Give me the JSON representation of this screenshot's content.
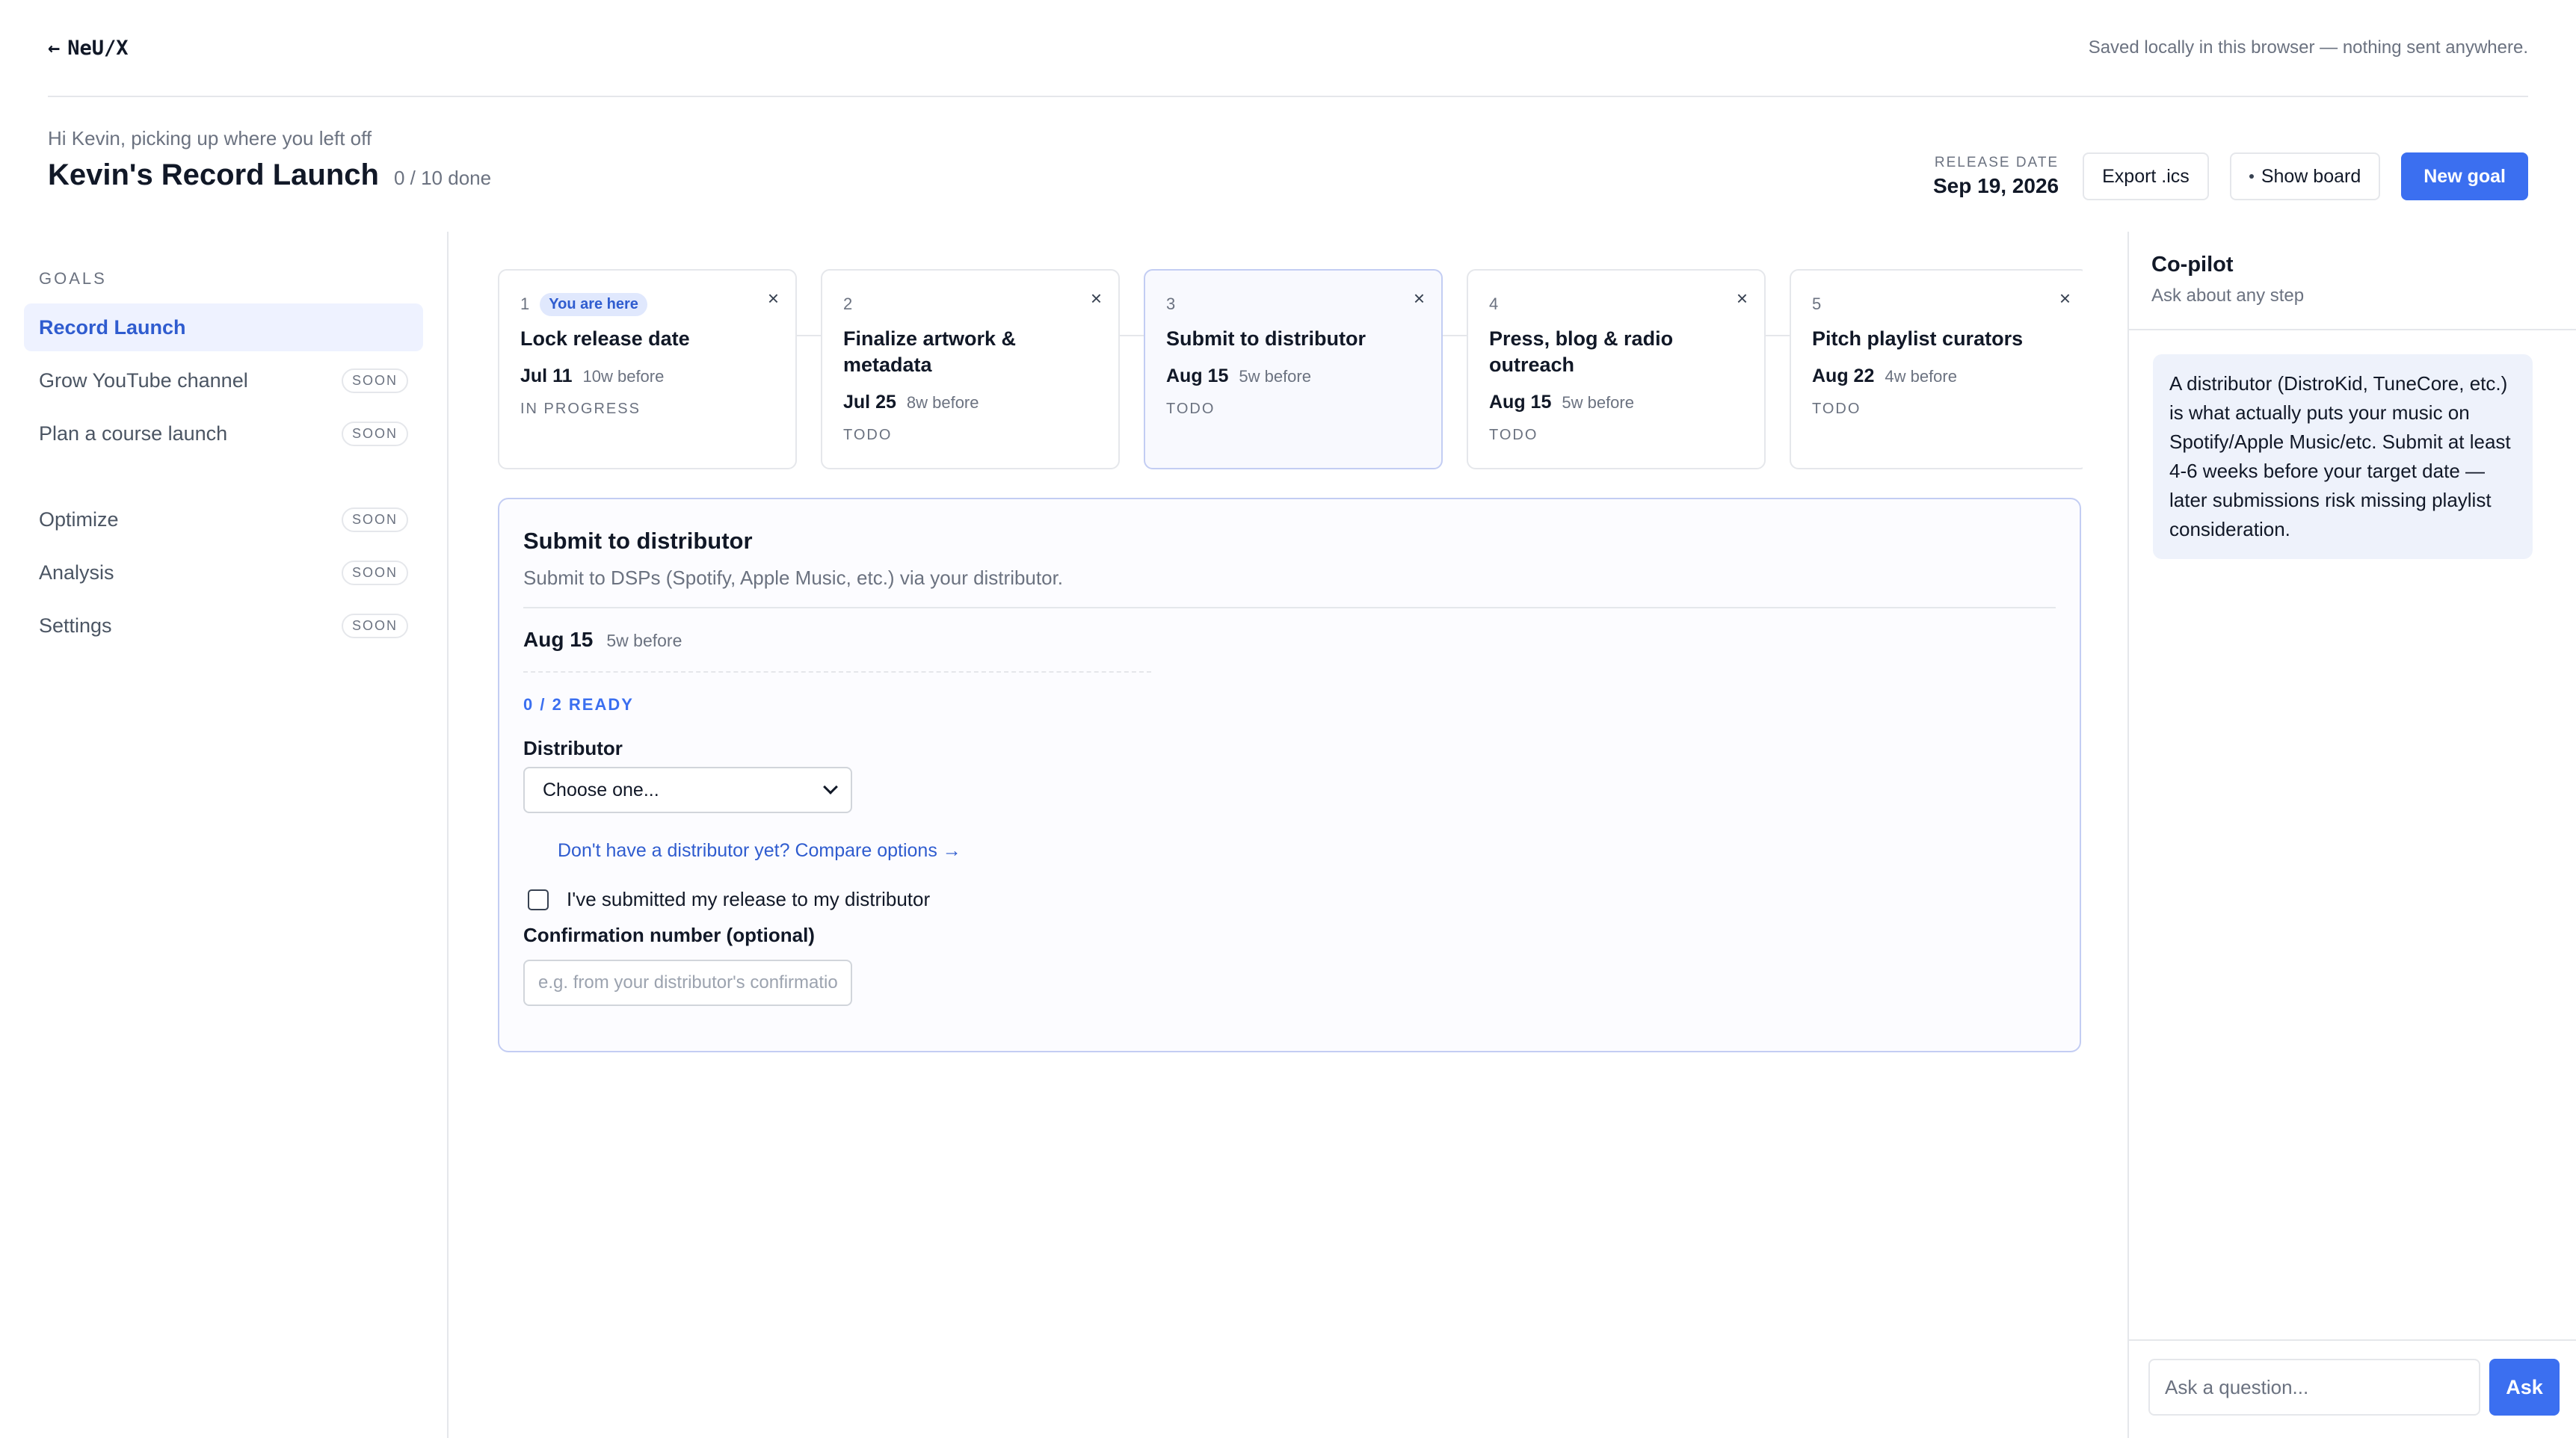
{
  "topbar": {
    "back_glyph": "←",
    "brand": "NeU/X",
    "saved_note": "Saved locally in this browser — nothing sent anywhere."
  },
  "header": {
    "greeting": "Hi Kevin, picking up where you left off",
    "title": "Kevin's Record Launch",
    "progress": "0 / 10 done",
    "release_label": "RELEASE DATE",
    "release_date": "Sep 19, 2026",
    "export_label": "Export .ics",
    "show_board_label": "Show board",
    "new_goal_label": "New goal"
  },
  "sidebar": {
    "heading": "GOALS",
    "items": [
      {
        "label": "Record Launch",
        "badge": ""
      },
      {
        "label": "Grow YouTube channel",
        "badge": "SOON"
      },
      {
        "label": "Plan a course launch",
        "badge": "SOON"
      },
      {
        "label": "Optimize",
        "badge": "SOON"
      },
      {
        "label": "Analysis",
        "badge": "SOON"
      },
      {
        "label": "Settings",
        "badge": "SOON"
      }
    ]
  },
  "steps": [
    {
      "num": "1",
      "badge": "You are here",
      "title": "Lock release date",
      "date": "Jul 11",
      "rel": "10w before",
      "status": "IN PROGRESS",
      "close": "×"
    },
    {
      "num": "2",
      "badge": "",
      "title": "Finalize artwork & metadata",
      "date": "Jul 25",
      "rel": "8w before",
      "status": "TODO",
      "close": "×"
    },
    {
      "num": "3",
      "badge": "",
      "title": "Submit to distributor",
      "date": "Aug 15",
      "rel": "5w before",
      "status": "TODO",
      "close": "×"
    },
    {
      "num": "4",
      "badge": "",
      "title": "Press, blog & radio outreach",
      "date": "Aug 15",
      "rel": "5w before",
      "status": "TODO",
      "close": "×"
    },
    {
      "num": "5",
      "badge": "",
      "title": "Pitch playlist curators",
      "date": "Aug 22",
      "rel": "4w before",
      "status": "TODO",
      "close": "×"
    }
  ],
  "detail": {
    "title": "Submit to distributor",
    "description": "Submit to DSPs (Spotify, Apple Music, etc.) via your distributor.",
    "date": "Aug 15",
    "rel": "5w before",
    "ready": "0 / 2 READY",
    "distributor_label": "Distributor",
    "distributor_value": "Choose one...",
    "compare_link": "Don't have a distributor yet? Compare options →",
    "checkbox_label": "I've submitted my release to my distributor",
    "confirmation_label": "Confirmation number (optional)",
    "confirmation_placeholder": "e.g. from your distributor's confirmation"
  },
  "copilot": {
    "title": "Co-pilot",
    "subtitle": "Ask about any step",
    "message": "A distributor (DistroKid, TuneCore, etc.) is what actually puts your music on Spotify/Apple Music/etc. Submit at least 4-6 weeks before your target date — later submissions risk missing playlist consideration.",
    "input_placeholder": "Ask a question...",
    "ask_label": "Ask"
  },
  "colors": {
    "accent": "#3b6ff0",
    "active_bg": "#eef2ff",
    "border": "#e5e7eb"
  }
}
